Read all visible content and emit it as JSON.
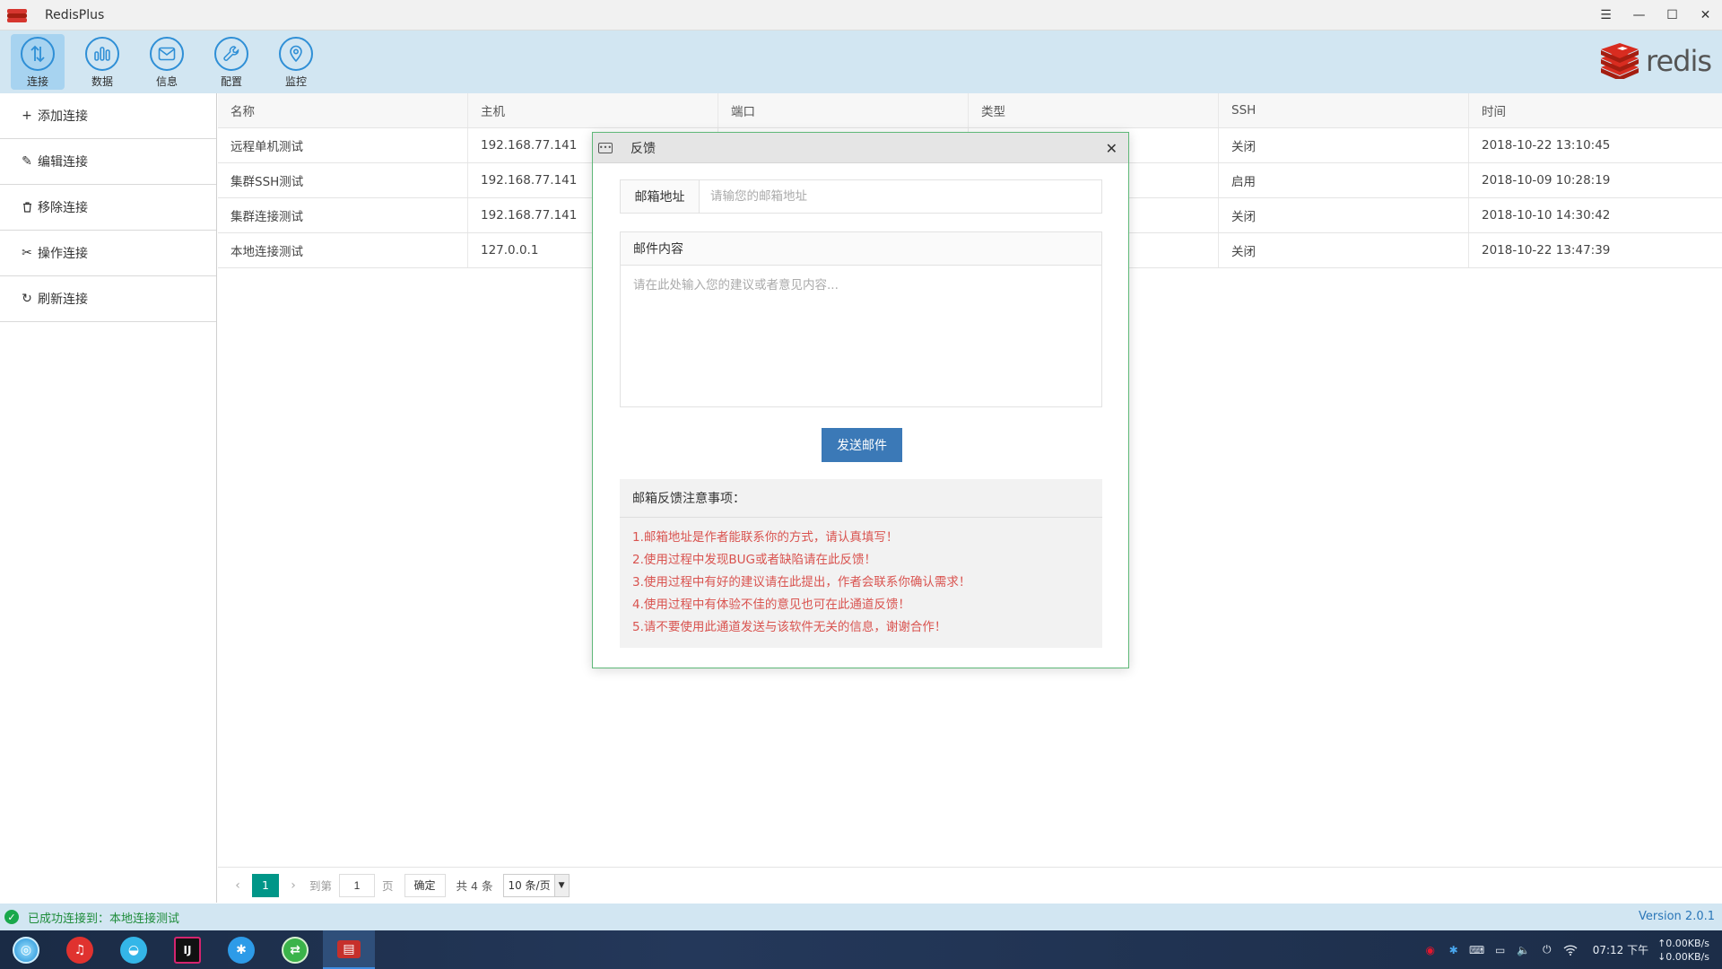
{
  "app": {
    "title": "RedisPlus",
    "logo_text": "redis"
  },
  "window_controls": [
    "menu-icon",
    "minimize-icon",
    "maximize-icon",
    "close-icon"
  ],
  "toolbar": {
    "items": [
      {
        "label": "连接",
        "icon": "connect-icon",
        "active": true
      },
      {
        "label": "数据",
        "icon": "chart-icon",
        "active": false
      },
      {
        "label": "信息",
        "icon": "mail-icon",
        "active": false
      },
      {
        "label": "配置",
        "icon": "wrench-icon",
        "active": false
      },
      {
        "label": "监控",
        "icon": "monitor-icon",
        "active": false
      }
    ]
  },
  "sidebar": {
    "items": [
      {
        "label": "添加连接",
        "icon": "plus-icon"
      },
      {
        "label": "编辑连接",
        "icon": "pencil-icon"
      },
      {
        "label": "移除连接",
        "icon": "trash-icon"
      },
      {
        "label": "操作连接",
        "icon": "tool-icon"
      },
      {
        "label": "刷新连接",
        "icon": "refresh-icon"
      }
    ]
  },
  "table": {
    "columns": [
      "名称",
      "主机",
      "端口",
      "类型",
      "SSH",
      "时间"
    ],
    "rows": [
      [
        "远程单机测试",
        "192.168.77.141",
        "",
        "",
        "关闭",
        "2018-10-22 13:10:45"
      ],
      [
        "集群SSH测试",
        "192.168.77.141",
        "",
        "",
        "启用",
        "2018-10-09 10:28:19"
      ],
      [
        "集群连接测试",
        "192.168.77.141",
        "",
        "",
        "关闭",
        "2018-10-10 14:30:42"
      ],
      [
        "本地连接测试",
        "127.0.0.1",
        "",
        "",
        "关闭",
        "2018-10-22 13:47:39"
      ]
    ]
  },
  "pager": {
    "current": "1",
    "goto_label": "到第",
    "page_input": "1",
    "page_unit": "页",
    "confirm": "确定",
    "total": "共 4 条",
    "page_size": "10 条/页"
  },
  "status": {
    "text": "已成功连接到：本地连接测试",
    "version": "Version 2.0.1"
  },
  "dialog": {
    "title": "反馈",
    "email_label": "邮箱地址",
    "email_placeholder": "请输您的邮箱地址",
    "content_label": "邮件内容",
    "content_placeholder": "请在此处输入您的建议或者意见内容...",
    "send_label": "发送邮件",
    "notes_title": "邮箱反馈注意事项：",
    "notes": [
      "1.邮箱地址是作者能联系你的方式，请认真填写！",
      "2.使用过程中发现BUG或者缺陷请在此反馈！",
      "3.使用过程中有好的建议请在此提出，作者会联系你确认需求！",
      "4.使用过程中有体验不佳的意见也可在此通道反馈！",
      "5.请不要使用此通道发送与该软件无关的信息，谢谢合作！"
    ]
  },
  "taskbar": {
    "time": "07:12 下午",
    "net_up": "↑0.00KB/s",
    "net_down": "↓0.00KB/s",
    "apps": [
      "deepin-launcher-icon",
      "music-icon",
      "browser-icon",
      "intellij-icon",
      "appstore-icon",
      "network-icon",
      "redisplus-icon"
    ]
  },
  "colors": {
    "accent": "#2f8fd6",
    "toolbar_bg": "#d2e6f2",
    "pager_active": "#009688",
    "send_button": "#3b79b7",
    "note_text": "#d9534f",
    "status_ok": "#19a84b"
  }
}
